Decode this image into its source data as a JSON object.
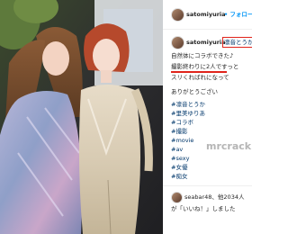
{
  "header": {
    "username": "satomiyuria",
    "follow_label": "• フォロー"
  },
  "caption": {
    "username": "satomiyuria",
    "mention": "凛音とうか",
    "lines": [
      "自然体にコラボできた♪",
      "撮影終わりに2人ですっと",
      "スリくればれになって",
      "ありがとうござい"
    ],
    "hashtags": [
      "#凛音とうか",
      "#里美ゆりあ",
      "#コラボ",
      "#撮影",
      "#movie",
      "#av",
      "#sexy",
      "#女優",
      "#痴女"
    ]
  },
  "watermark": "mrcrack",
  "likes": {
    "summary": "seabar48、他2034人",
    "suffix": "が「いいね！」しました"
  },
  "colors": {
    "link": "#00376b",
    "follow": "#0095f6",
    "annotation": "#e0241b"
  },
  "icons": [
    "profile-avatar",
    "heart-icon"
  ]
}
